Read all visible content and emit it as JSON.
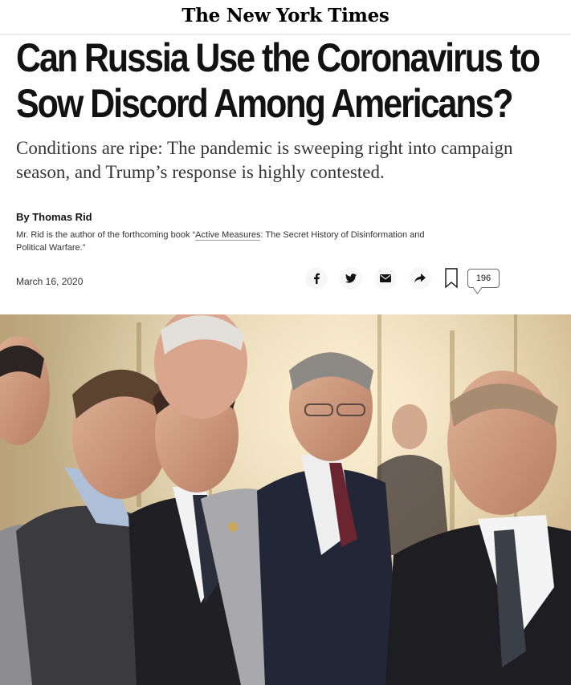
{
  "masthead": {
    "title": "The New York Times"
  },
  "article": {
    "headline": "Can Russia Use the Coronavirus to Sow Discord Among Americans?",
    "summary": "Conditions are ripe: The pandemic is sweeping right into campaign season, and Trump’s response is highly contested.",
    "byline": "By Thomas Rid",
    "bio": {
      "prefix": "Mr. Rid is the author of the forthcoming book “",
      "book_title": "Active Measures",
      "suffix": ": The Secret History of Disinformation and Political Warfare.”"
    },
    "date": "March 16, 2020"
  },
  "share": {
    "facebook_icon": "facebook-icon",
    "twitter_icon": "twitter-icon",
    "email_icon": "email-icon",
    "share_icon": "share-arrow-icon",
    "bookmark_icon": "bookmark-icon",
    "comment_count": "196"
  },
  "photo": {
    "description_icon": "article-photo"
  },
  "colors": {
    "text": "#121212",
    "icon_bg": "#f7f7f7",
    "background": "#ffffff"
  }
}
